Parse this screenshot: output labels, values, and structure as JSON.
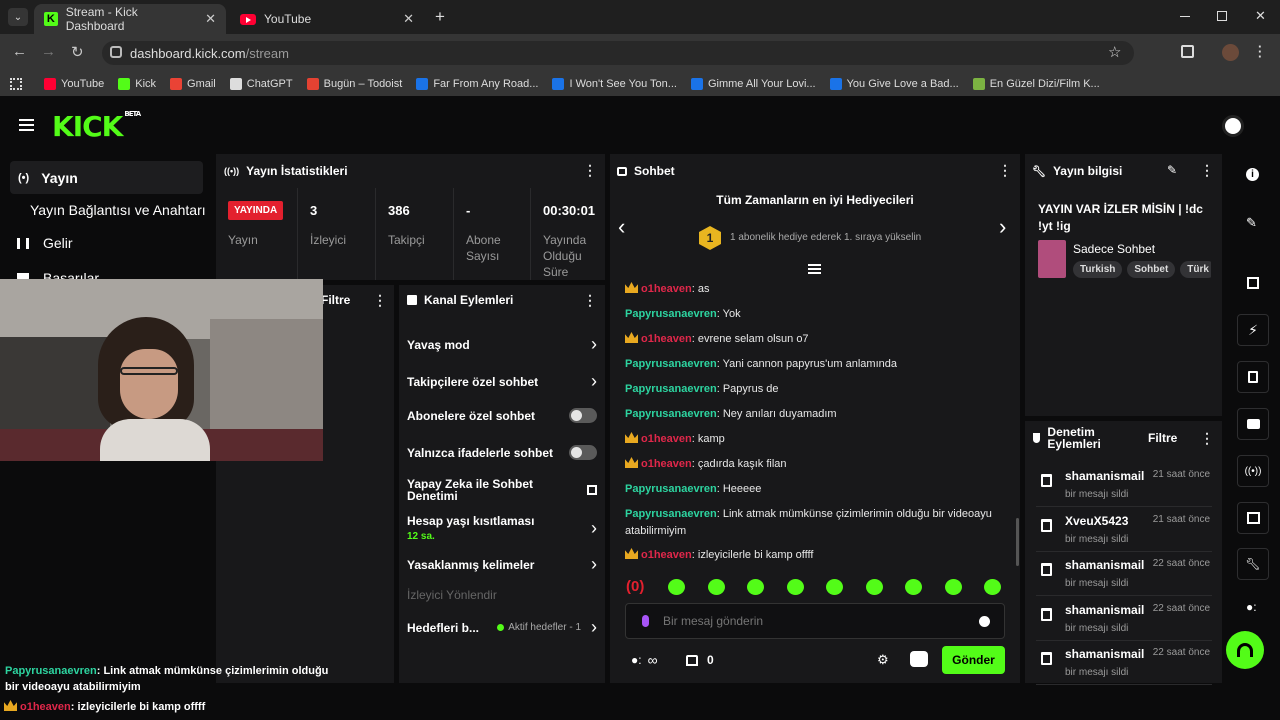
{
  "browser": {
    "tabs": [
      {
        "label": "Stream - Kick Dashboard",
        "close": "✕"
      },
      {
        "label": "YouTube",
        "close": "✕"
      }
    ],
    "new_tab": "+",
    "url_host": "dashboard.kick.com",
    "url_path": "/stream",
    "bookmarks": [
      {
        "label": "YouTube",
        "color": "#ff0033"
      },
      {
        "label": "Kick",
        "color": "#53fc18"
      },
      {
        "label": "Gmail",
        "color": "#ea4335"
      },
      {
        "label": "ChatGPT",
        "color": "#dddddd"
      },
      {
        "label": "Bugün – Todoist",
        "color": "#e44232"
      },
      {
        "label": "Far From Any Road...",
        "color": "#1a73e8"
      },
      {
        "label": "I Won't See You Ton...",
        "color": "#1a73e8"
      },
      {
        "label": "Gimme All Your Lovi...",
        "color": "#1a73e8"
      },
      {
        "label": "You Give Love a Bad...",
        "color": "#1a73e8"
      },
      {
        "label": "En Güzel Dizi/Film K...",
        "color": "#7cb342"
      }
    ]
  },
  "kick": {
    "logo": "KICK",
    "logo_badge": "BETA",
    "sidebar": {
      "items": [
        {
          "label": "Yayın"
        },
        {
          "label": "Yayın Bağlantısı ve Anahtarı"
        },
        {
          "label": "Gelir"
        },
        {
          "label": "Başarılar"
        }
      ]
    },
    "stats": {
      "title": "Yayın İstatistikleri",
      "live_badge": "YAYINDA",
      "live_label": "Yayın",
      "cols": [
        {
          "value": "3",
          "label": "İzleyici"
        },
        {
          "value": "386",
          "label": "Takipçi"
        },
        {
          "value": "-",
          "label": "Abone Sayısı"
        },
        {
          "value": "00:30:01",
          "label": "Yayında Olduğu Süre"
        }
      ]
    },
    "filter_panel": {
      "title": "Filtre"
    },
    "channel_actions": {
      "title": "Kanal Eylemleri",
      "items": [
        {
          "label": "Yavaş mod"
        },
        {
          "label": "Takipçilere özel sohbet"
        },
        {
          "label": "Abonelere özel sohbet"
        },
        {
          "label": "Yalnızca ifadelerle sohbet"
        },
        {
          "label": "Yapay Zeka ile Sohbet Denetimi"
        },
        {
          "label": "Hesap yaşı kısıtlaması",
          "sub": "12 sa."
        },
        {
          "label": "Yasaklanmış kelimeler"
        }
      ],
      "section": "İzleyici Yönlendir",
      "goals_label": "Hedefleri b...",
      "goals_status": "Aktif hedefler - 1"
    },
    "chat": {
      "title": "Sohbet",
      "gifters_title": "Tüm Zamanların en iyi Hediyecileri",
      "gifters_text": "1 abonelik hediye ederek 1. sıraya yükselin",
      "rank_badge": "1",
      "messages": [
        {
          "user": "o1heaven",
          "text": "as",
          "vip": true
        },
        {
          "user": "Papyrusanaevren",
          "text": "Yok",
          "vip": false
        },
        {
          "user": "o1heaven",
          "text": "evrene selam olsun o7",
          "vip": true
        },
        {
          "user": "Papyrusanaevren",
          "text": "Yani cannon papyrus'um anlamında",
          "vip": false
        },
        {
          "user": "Papyrusanaevren",
          "text": "Papyrus de",
          "vip": false
        },
        {
          "user": "Papyrusanaevren",
          "text": "Ney anıları duyamadım",
          "vip": false
        },
        {
          "user": "o1heaven",
          "text": "kamp",
          "vip": true
        },
        {
          "user": "o1heaven",
          "text": "çadırda kaşık filan",
          "vip": true
        },
        {
          "user": "Papyrusanaevren",
          "text": "Heeeee",
          "vip": false
        },
        {
          "user": "Papyrusanaevren",
          "text": "Link atmak mümkünse çizimlerimin olduğu bir videoayu atabilirmiyim",
          "vip": false
        },
        {
          "user": "o1heaven",
          "text": "izleyicilerle bi kamp offff",
          "vip": true
        }
      ],
      "emote_first": "(0)",
      "input_placeholder": "Bir mesaj gönderin",
      "points": "∞",
      "chest_count": "0",
      "send_label": "Gönder",
      "name_color_vip": "#e0274a",
      "name_color_regular": "#2dd4a0"
    },
    "stream_info": {
      "title": "Yayın bilgisi",
      "stream_title": "YAYIN VAR İZLER MİSİN | !dc !yt !ig",
      "category": "Sadece Sohbet",
      "tags": [
        "Turkish",
        "Sohbet",
        "Türk"
      ]
    },
    "mod_actions": {
      "title": "Denetim Eylemleri",
      "filter": "Filtre",
      "entries": [
        {
          "user": "shamanismail",
          "action": "bir mesajı sildi",
          "time": "21 saat önce"
        },
        {
          "user": "XveuX5423",
          "action": "bir mesajı sildi",
          "time": "21 saat önce"
        },
        {
          "user": "shamanismail",
          "action": "bir mesajı sildi",
          "time": "22 saat önce"
        },
        {
          "user": "shamanismail",
          "action": "bir mesajı sildi",
          "time": "22 saat önce"
        },
        {
          "user": "shamanismail",
          "action": "bir mesajı sildi",
          "time": "22 saat önce"
        }
      ]
    },
    "overlay_chat": [
      {
        "user": "Papyrusanaevren",
        "text": "Link atmak mümkünse çizimlerimin olduğu bir videoayu atabilirmiyim"
      },
      {
        "user": "o1heaven",
        "text": "izleyicilerle bi kamp offff"
      }
    ]
  },
  "colors": {
    "brand": "#53fc18",
    "live": "#e3202e",
    "panel": "#18181a"
  }
}
